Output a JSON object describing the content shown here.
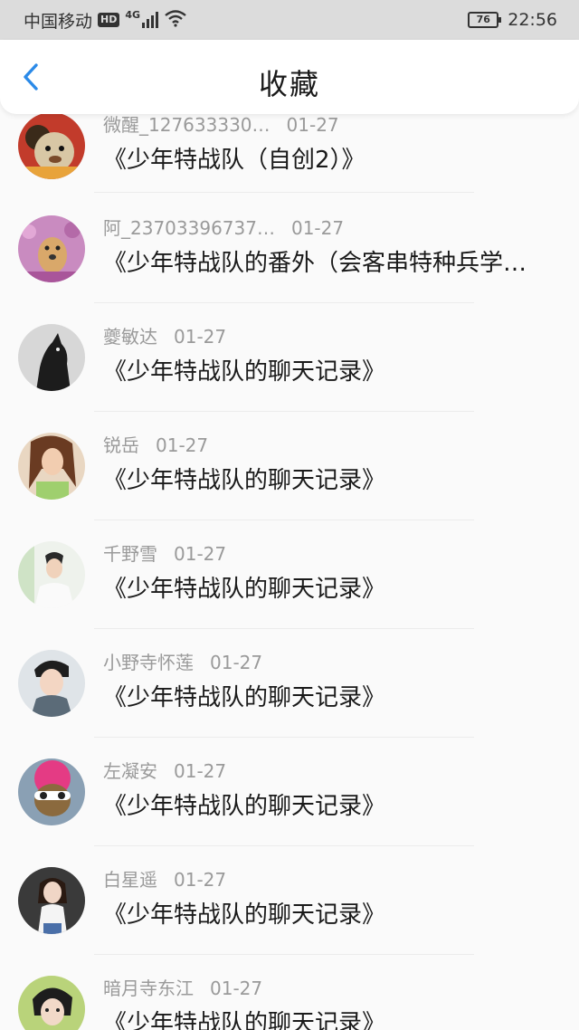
{
  "status_bar": {
    "carrier": "中国移动",
    "hd": "HD",
    "network": "4G",
    "battery": "76",
    "time": "22:56"
  },
  "nav": {
    "title": "收藏",
    "back_icon": "chevron-left-icon",
    "accent_color": "#2b8ae8"
  },
  "items": [
    {
      "author": "微醒_127633330…",
      "date": "01-27",
      "title": "《少年特战队（自创2）》"
    },
    {
      "author": "阿_23703396737…",
      "date": "01-27",
      "title": "《少年特战队的番外（会客串特种兵学…"
    },
    {
      "author": "夔敏达",
      "date": "01-27",
      "title": "《少年特战队的聊天记录》"
    },
    {
      "author": "锐岳",
      "date": "01-27",
      "title": "《少年特战队的聊天记录》"
    },
    {
      "author": "千野雪",
      "date": "01-27",
      "title": "《少年特战队的聊天记录》"
    },
    {
      "author": "小野寺怀莲",
      "date": "01-27",
      "title": "《少年特战队的聊天记录》"
    },
    {
      "author": "左凝安",
      "date": "01-27",
      "title": "《少年特战队的聊天记录》"
    },
    {
      "author": "白星遥",
      "date": "01-27",
      "title": "《少年特战队的聊天记录》"
    },
    {
      "author": "暗月寺东江",
      "date": "01-27",
      "title": "《少年特战队的聊天记录》"
    }
  ]
}
